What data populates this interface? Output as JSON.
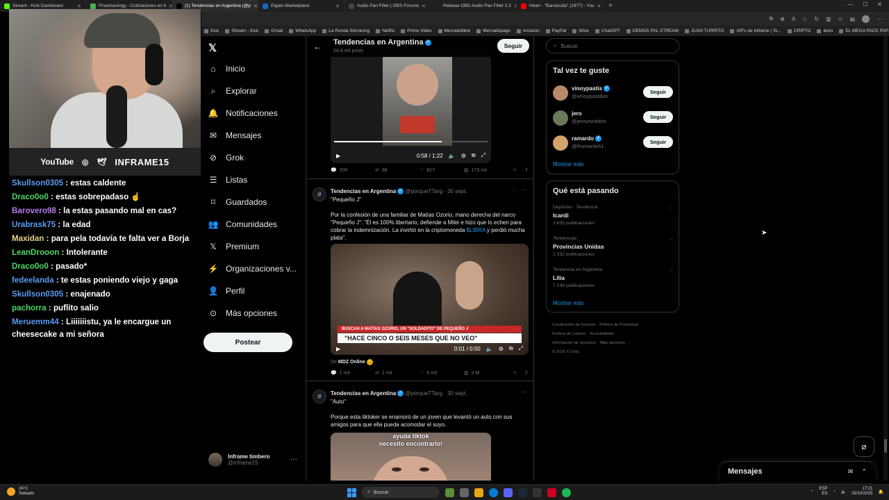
{
  "browser": {
    "tabs": [
      {
        "title": "Stream - Kick Dashboard",
        "color": "#53fc18",
        "active": false
      },
      {
        "title": "FinanzasArgy - Cotizaciones en ti",
        "color": "#4caf50",
        "active": false
      },
      {
        "title": "(1) Tendencias en Argentina (@p",
        "color": "#000000",
        "active": true
      },
      {
        "title": "Elgato Marketplace",
        "color": "#1565c0",
        "active": false
      },
      {
        "title": "Audio Pan Filter | OBS Forums",
        "color": "#444444",
        "active": false
      },
      {
        "title": "Release OBS Audio Pan Filter 0.2",
        "color": "#222222",
        "active": false
      },
      {
        "title": "Heart - \"Barracuda\" (1977) - You",
        "color": "#ff0000",
        "active": false
      }
    ],
    "bookmarks": [
      "Kick",
      "Stream - Kick",
      "Gmail",
      "WhatsApp",
      "La Ronda Simracing",
      "Netflix",
      "Prime Video",
      "Mercadolibre",
      "Mercadopago",
      "Amazon",
      "PayPal",
      "Wise",
      "ChatGPT",
      "DEMOS PAL STREAM",
      "JUAN TURRITO",
      "GIFs de Inframe | Te...",
      "CRIPTO",
      "aires",
      "EL MEGA PACK PAP..."
    ]
  },
  "stream": {
    "social": {
      "youtube": "YouTube",
      "handle": "INFRAME15"
    },
    "chat": [
      {
        "user": "Skullson0305",
        "color": "#5b9bf0",
        "text": ": estas caldente"
      },
      {
        "user": "Draco0o0",
        "color": "#4cd964",
        "text": ": estas sobrepadaso ☝"
      },
      {
        "user": "Barovero98",
        "color": "#b57cf2",
        "text": ": la estas pasando mal en cas?"
      },
      {
        "user": "Urabrask75",
        "color": "#5b9bf0",
        "text": ": la edad"
      },
      {
        "user": "Maxidan",
        "color": "#e8d08a",
        "text": ": para pela todavía te falta ver a Borja"
      },
      {
        "user": "LeanDrooon",
        "color": "#4cd964",
        "text": ": Intolerante"
      },
      {
        "user": "Draco0o0",
        "color": "#4cd964",
        "text": ": pasado*"
      },
      {
        "user": "fedeelanda",
        "color": "#5b9bf0",
        "text": ": te estas poniendo viejo y gaga"
      },
      {
        "user": "Skullson0305",
        "color": "#5b9bf0",
        "text": ": enajenado"
      },
      {
        "user": "pachorra",
        "color": "#4cd964",
        "text": ": puflito salio"
      },
      {
        "user": "Meruemm44",
        "color": "#5b9bf0",
        "text": ": Liiiiiiistu, ya le encargue un cheesecake a mi señora"
      }
    ]
  },
  "nav": {
    "items": [
      "Inicio",
      "Explorar",
      "Notificaciones",
      "Mensajes",
      "Grok",
      "Listas",
      "Guardados",
      "Comunidades",
      "Premium",
      "Organizaciones v...",
      "Perfil",
      "Más opciones"
    ],
    "post_button": "Postear",
    "profile": {
      "name": "Inframe timbero",
      "handle": "@inframe15"
    }
  },
  "feed": {
    "title": "Tendencias en Argentina",
    "count": "54,9 mil posts",
    "follow": "Seguir",
    "first_video": {
      "time": "0:58 / 1:22"
    },
    "first_stats": {
      "replies": "200",
      "reposts": "88",
      "likes": "817",
      "views": "173 mil"
    },
    "posts": [
      {
        "author": "Tendencias en Argentina",
        "handle": "@porqueTTarg · 30 sept.",
        "quote": "\"Pequeño J\"",
        "body_pre": "Por la confesión de una familiar de Matías Ozorio, mano derecha del narco \"Pequeño J\": \"Él es 100% libertario, defiende a Milei e hizo que lo echen para cobrar la indemnización. La invirtió en la criptomoneda ",
        "body_link": "$LIBRA",
        "body_post": " y perdió mucha plata\".",
        "video_time": "0:01 / 0:50",
        "ticker_top": "BUSCAN A MATÍAS OZORIO, UN \"SOLDADITO\" DE PEQUEÑO J",
        "ticker_main": "\"HACE CINCO O SEIS MESES QUE NO VEO\"",
        "source_prefix": "De",
        "source": "MDZ Online",
        "stats": {
          "replies": "1 mil",
          "reposts": "1 mil",
          "likes": "9 mil",
          "views": "2 M"
        }
      },
      {
        "author": "Tendencias en Argentina",
        "handle": "@porqueTTarg · 30 sept.",
        "quote": "\"Auto\"",
        "body": "Porque esta tiktoker se enamoró de un joven que levantó un auto con sus amigos para que ella pueda acomodar el suyo.",
        "caption1": "ayuda tiktok",
        "caption2": "necesito encontrarlo!"
      }
    ]
  },
  "sidebar": {
    "search_placeholder": "Buscar",
    "who_title": "Tal vez te guste",
    "who": [
      {
        "name": "vinoypastis",
        "handle": "@vinoypastillas",
        "btn": "Seguir",
        "color": "#b98a6a"
      },
      {
        "name": "jero",
        "handle": "@jeroveintidos",
        "btn": "Seguir",
        "color": "#6a7a5a"
      },
      {
        "name": "ramardo",
        "handle": "@Ramardoh1",
        "btn": "Seguir",
        "color": "#d4a36a"
      }
    ],
    "show_more": "Mostrar más",
    "trends_title": "Qué está pasando",
    "trends": [
      {
        "category": "Deportes · Tendencia",
        "name": "Icardi",
        "count": "3.635 publicaciones"
      },
      {
        "category": "Tendencias",
        "name": "Provincias Unidas",
        "count": "2.332 publicaciones"
      },
      {
        "category": "Tendencia en Argentina",
        "name": "Lilia",
        "count": "7.199 publicaciones"
      }
    ],
    "footer": [
      "Condiciones de Servicio",
      "Política de Privacidad",
      "Política de cookies",
      "Accesibilidad",
      "Información de anuncios",
      "Más opciones ···",
      "© 2025 X Corp."
    ]
  },
  "dm": {
    "title": "Mensajes"
  },
  "taskbar": {
    "weather_temp": "24°C",
    "weather_desc": "Soleado",
    "search": "Buscar",
    "lang1": "ESP",
    "lang2": "ES",
    "time": "17:21",
    "date": "02/10/2025"
  }
}
